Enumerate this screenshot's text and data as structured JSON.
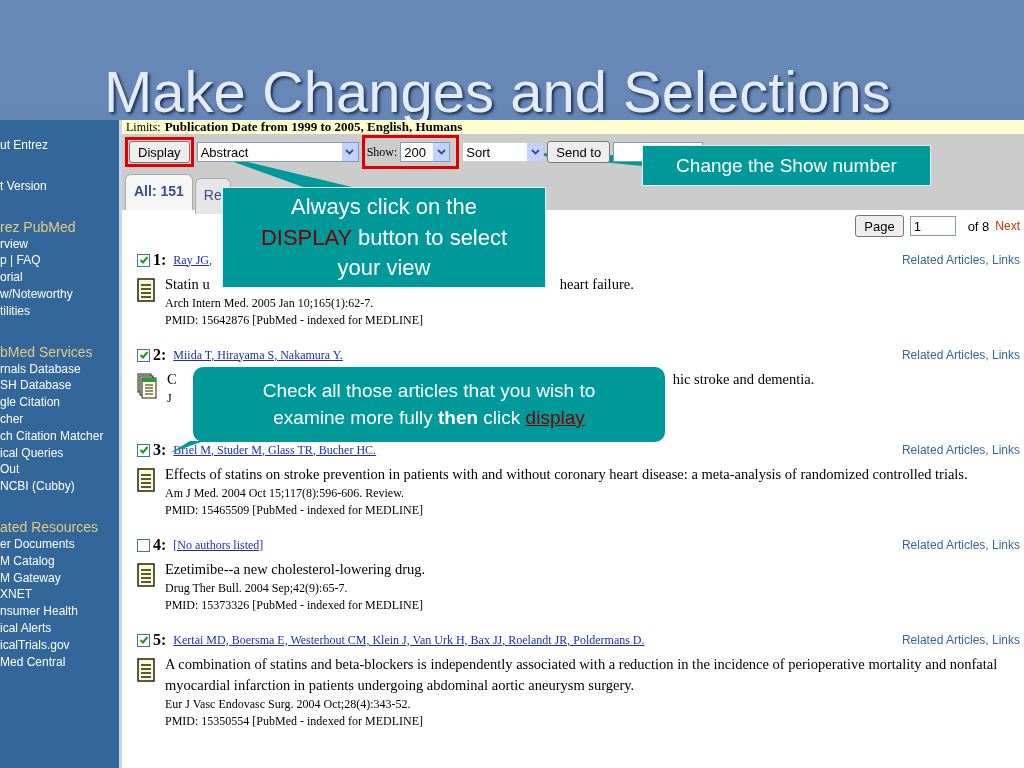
{
  "slide": {
    "title": "Make Changes and Selections"
  },
  "sidebar": [
    {
      "items": [
        "ut Entrez"
      ]
    },
    {
      "items": [
        "t Version"
      ]
    },
    {
      "heading": "rez PubMed",
      "items": [
        "rview",
        "p | FAQ",
        "orial",
        "w/Noteworthy",
        "tilities"
      ]
    },
    {
      "heading": "bMed Services",
      "items": [
        "rnals Database",
        "SH Database",
        "gle Citation",
        "cher",
        "ch Citation Matcher",
        "ical Queries",
        "Out",
        "NCBI (Cubby)"
      ]
    },
    {
      "heading": "ated Resources",
      "items": [
        "er Documents",
        "M Catalog",
        "M Gateway",
        "XNET",
        "nsumer Health",
        "ical Alerts",
        "icalTrials.gov",
        "Med Central"
      ]
    }
  ],
  "limits": {
    "label": "Limits:",
    "value": "Publication Date from 1999 to 2005, English, Humans"
  },
  "toolbar": {
    "display_button": "Display",
    "format_select": "Abstract",
    "show_label": "Show:",
    "show_select": "200",
    "sort_select": "Sort",
    "send_button": "Send to"
  },
  "tabs": [
    {
      "label": "All: 151",
      "selected": true
    },
    {
      "label": "Re",
      "selected": false
    }
  ],
  "pager": {
    "button": "Page",
    "page": "1",
    "of": "of 8",
    "next": "Next"
  },
  "results": [
    {
      "number": "1:",
      "checked": true,
      "kind": "single",
      "authors": "Ray JG,",
      "links": "Related Articles, Links",
      "title_parts": [
        "Statin u",
        "heart failure."
      ],
      "journal": "Arch Intern Med. 2005 Jan 10;165(1):62-7.",
      "pmid": "PMID: 15642876 [PubMed - indexed for MEDLINE]"
    },
    {
      "number": "2:",
      "checked": true,
      "kind": "stack",
      "authors": "Miida T, Hirayama S, Nakamura Y.",
      "links": "Related Articles, Links",
      "title_parts": [
        "C",
        "hic stroke and dementia."
      ],
      "journal": "J"
    },
    {
      "number": "3:",
      "checked": true,
      "kind": "single",
      "authors": "Briel M, Studer M, Glass TR, Bucher HC.",
      "links": "Related Articles, Links",
      "title_parts": [
        "Effects of statins on stroke prevention in patients with and without coronary heart disease: a meta-analysis of randomized controlled trials."
      ],
      "journal": "Am J Med. 2004 Oct 15;117(8):596-606. Review.",
      "pmid": "PMID: 15465509 [PubMed - indexed for MEDLINE]"
    },
    {
      "number": "4:",
      "checked": false,
      "kind": "single",
      "authors": "[No authors listed]",
      "links": "Related Articles, Links",
      "title_parts": [
        "Ezetimibe--a new cholesterol-lowering drug."
      ],
      "journal": "Drug Ther Bull. 2004 Sep;42(9):65-7.",
      "pmid": "PMID: 15373326 [PubMed - indexed for MEDLINE]"
    },
    {
      "number": "5:",
      "checked": true,
      "kind": "single",
      "authors": "Kertai MD, Boersma E, Westerhout CM, Klein J, Van Urk H, Bax JJ, Roelandt JR, Poldermans D.",
      "links": "Related Articles, Links",
      "title_parts": [
        "A combination of statins and beta-blockers is independently associated with a reduction in the incidence of perioperative mortality and nonfatal myocardial infarction in patients undergoing abdominal aortic aneurysm surgery."
      ],
      "journal": "Eur J Vasc Endovasc Surg. 2004 Oct;28(4):343-52.",
      "pmid": "PMID: 15350554 [PubMed - indexed for MEDLINE]"
    }
  ],
  "callouts": [
    {
      "kind": "display",
      "parts": [
        {
          "kind": "plain",
          "text": "Always click on the "
        },
        {
          "kind": "red",
          "text": "DISPLAY"
        },
        {
          "kind": "plain",
          "text": " button to select your view"
        }
      ]
    },
    {
      "kind": "show",
      "parts": [
        {
          "kind": "plain",
          "text": "Change the Show number"
        }
      ]
    },
    {
      "kind": "check",
      "parts": [
        {
          "kind": "plain",
          "text": "Check all those articles that you wish to examine more fully "
        },
        {
          "kind": "bold",
          "text": "then"
        },
        {
          "kind": "plain",
          "text": " click "
        },
        {
          "kind": "link",
          "text": "display"
        }
      ]
    }
  ]
}
